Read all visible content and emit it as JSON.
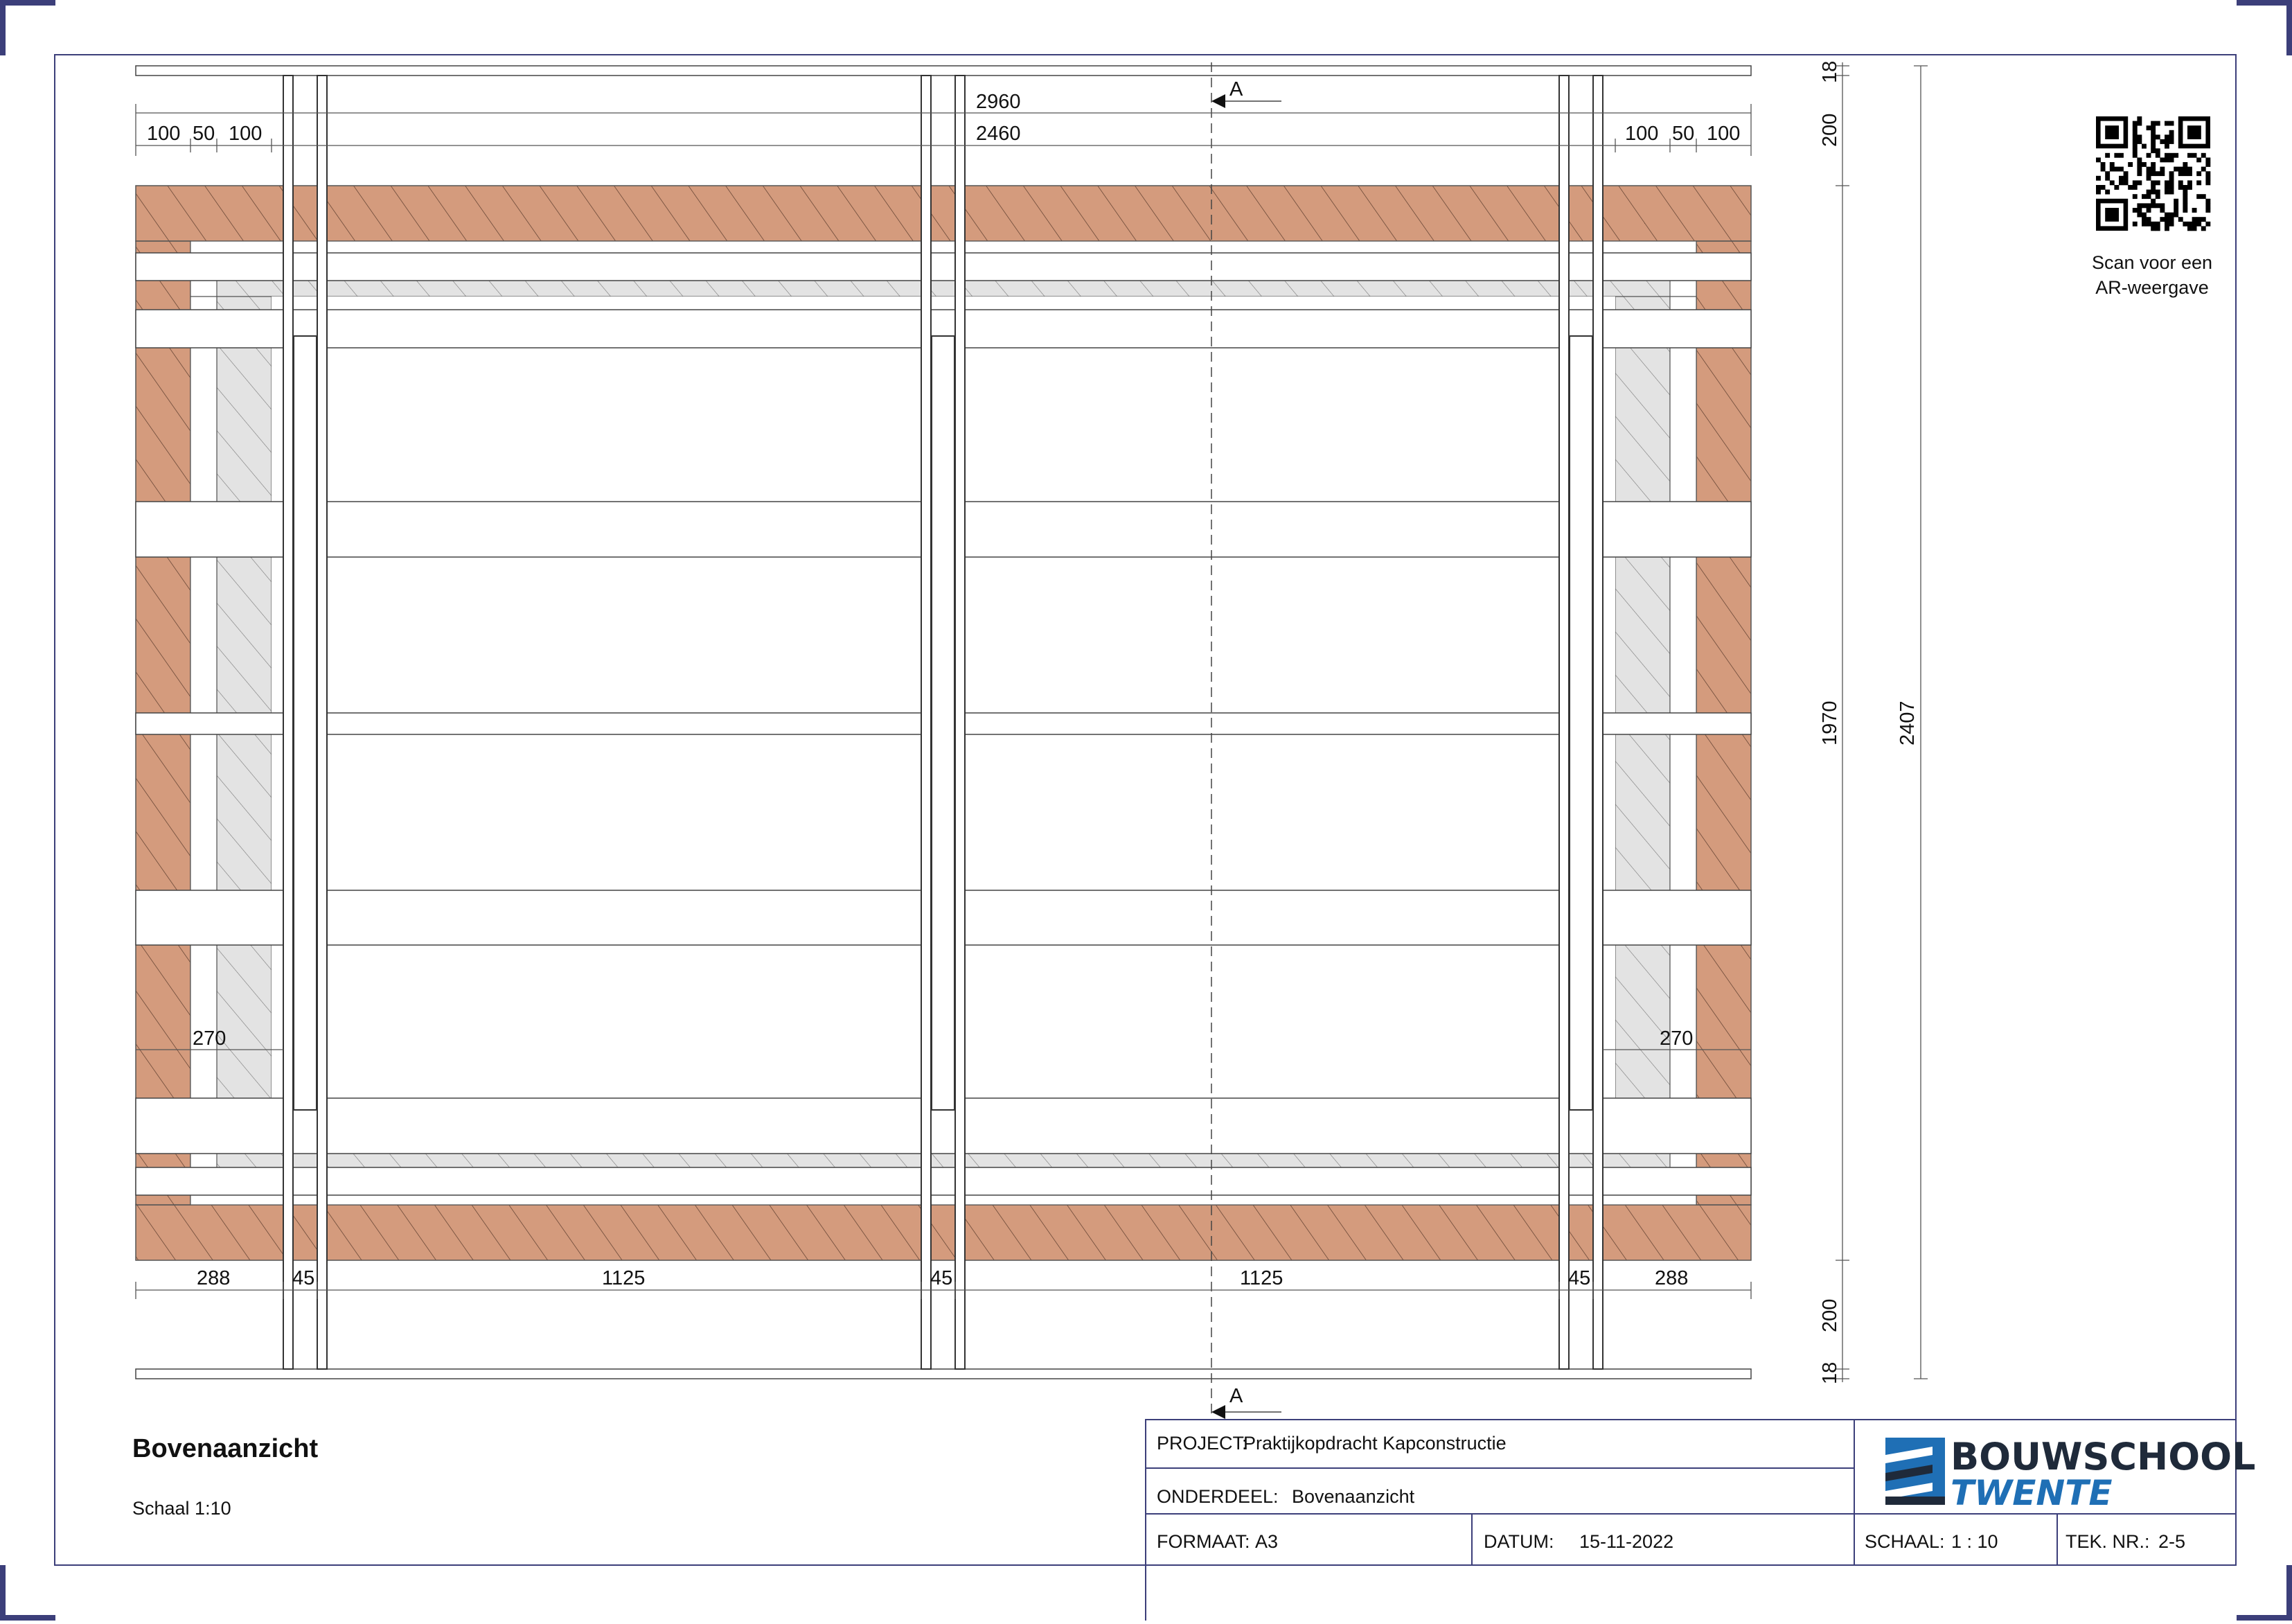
{
  "colors": {
    "border": "#3c3f7a",
    "brick": "#d49b7d",
    "insulation": "#e3e3e3",
    "line": "#333333",
    "logo_dark": "#1f2a3a",
    "logo_blue": "#1f6fb5"
  },
  "dimensions": {
    "top_total": "2960",
    "top_inner": "2460",
    "top_left": [
      "100",
      "50",
      "100"
    ],
    "top_right": [
      "100",
      "50",
      "100"
    ],
    "right_outer": "2407",
    "right_top_a": "18",
    "right_top_b": "200",
    "right_mid": "1970",
    "right_bot_b": "200",
    "right_bot_a": "18",
    "left_270": "270",
    "right_270": "270",
    "bottom": [
      "288",
      "45",
      "1125",
      "45",
      "1125",
      "45",
      "288"
    ]
  },
  "section_marker": "A",
  "qr": {
    "caption_line1": "Scan voor een",
    "caption_line2": "AR-weergave",
    "icon": "qr-code-icon"
  },
  "drawing": {
    "title": "Bovenaanzicht",
    "scale": "Schaal 1:10"
  },
  "title_block": {
    "project_label": "PROJECT:",
    "project_value": "Praktijkopdracht Kapconstructie",
    "onderdeel_label": "ONDERDEEL:",
    "onderdeel_value": "Bovenaanzicht",
    "formaat_label": "FORMAAT:",
    "formaat_value": "A3",
    "datum_label": "DATUM:",
    "datum_value": "15-11-2022",
    "schaal_label": "SCHAAL:",
    "schaal_value": "1 : 10",
    "teknr_label": "TEK. NR.:",
    "teknr_value": "2-5",
    "logo_line1": "BOUWSCHOOL",
    "logo_line2": "TWENTE"
  }
}
